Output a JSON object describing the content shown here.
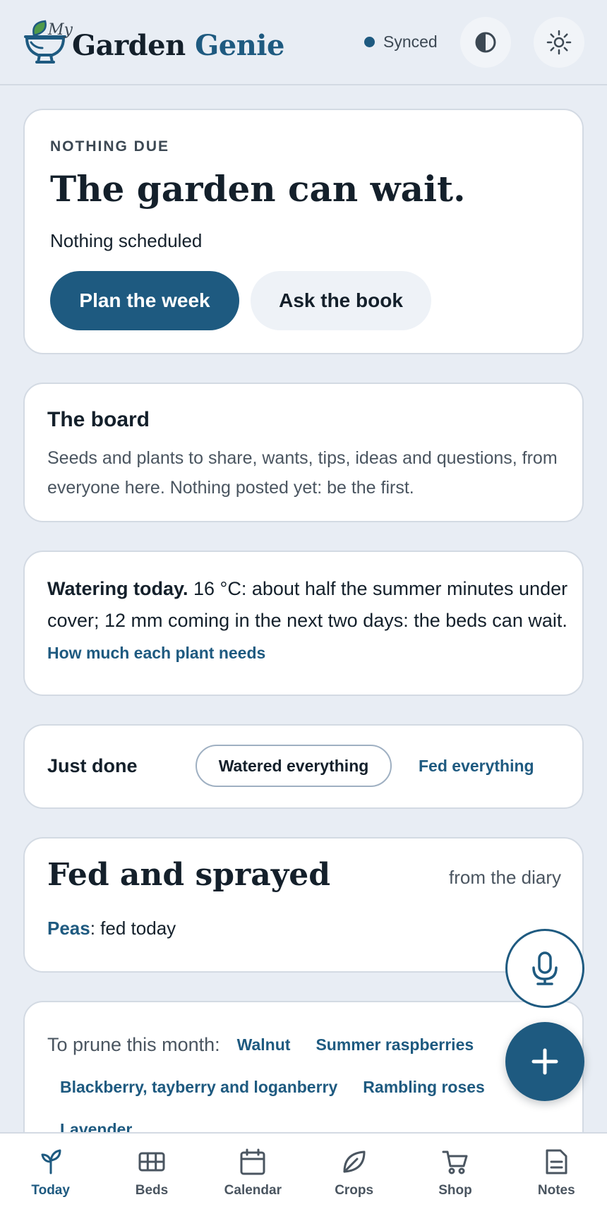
{
  "header": {
    "logo_my": "My",
    "logo_word1": "Garden",
    "logo_word2": "Genie",
    "sync_status": "Synced",
    "colors": {
      "brand": "#1e5a80",
      "ink": "#14202b",
      "background": "#e8edf4"
    }
  },
  "hero": {
    "kicker": "NOTHING DUE",
    "title": "The garden can wait.",
    "subtitle": "Nothing scheduled",
    "primary_button": "Plan the week",
    "secondary_button": "Ask the book"
  },
  "board": {
    "title": "The board",
    "body": "Seeds and plants to share, wants, tips, ideas and questions, from everyone here. Nothing posted yet: be the first."
  },
  "watering": {
    "lead": "Watering today.",
    "body": " 16 °C: about half the summer minutes under cover; 12 mm coming in the next two days: the beds can wait. ",
    "link": "How much each plant needs"
  },
  "just_done": {
    "label": "Just done",
    "option1": "Watered everything",
    "option2": "Fed everything"
  },
  "fed_sprayed": {
    "title": "Fed and sprayed",
    "source": "from the diary",
    "entry_crop": "Peas",
    "entry_text": ": fed today"
  },
  "prune": {
    "label": "To prune this month:",
    "items": [
      "Walnut",
      "Summer raspberries",
      "Blackberry, tayberry and loganberry",
      "Rambling roses",
      "Lavender"
    ]
  },
  "fabs": {
    "mic_icon": "microphone-icon",
    "add_icon": "plus-icon"
  },
  "nav": {
    "items": [
      {
        "label": "Today",
        "icon": "sprout-icon",
        "active": true
      },
      {
        "label": "Beds",
        "icon": "grid-icon"
      },
      {
        "label": "Calendar",
        "icon": "calendar-icon"
      },
      {
        "label": "Crops",
        "icon": "leaf-icon"
      },
      {
        "label": "Shop",
        "icon": "cart-icon"
      },
      {
        "label": "Notes",
        "icon": "note-icon"
      }
    ]
  }
}
